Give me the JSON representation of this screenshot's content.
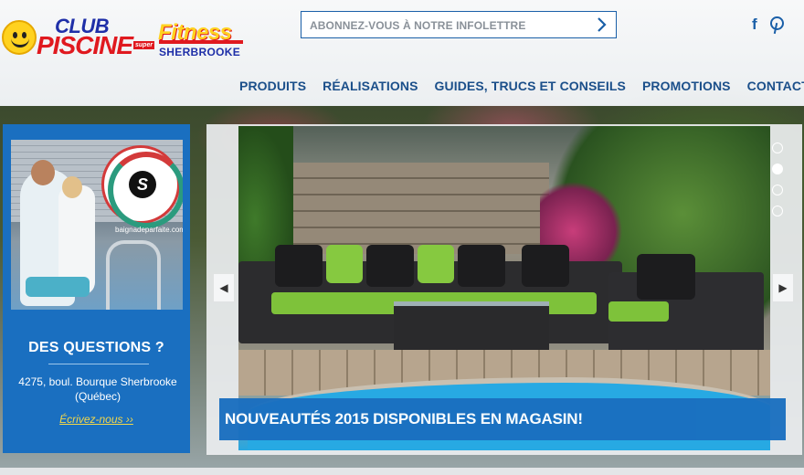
{
  "header": {
    "logo": {
      "club": "CLUB",
      "piscine": "PISCINE",
      "super": "super",
      "fitness": "Fitness",
      "location": "SHERBROOKE"
    },
    "newsletter": {
      "label": "ABONNEZ-VOUS À NOTRE INFOLETTRE",
      "arrow_icon": "chevron-right-icon"
    },
    "social": [
      {
        "name": "facebook-icon",
        "glyph": "f"
      },
      {
        "name": "pinterest-icon",
        "glyph": "p"
      }
    ]
  },
  "nav": {
    "items": [
      {
        "label": "PRODUITS"
      },
      {
        "label": "RÉALISATIONS"
      },
      {
        "label": "GUIDES, TRUCS ET CONSEILS"
      },
      {
        "label": "PROMOTIONS"
      },
      {
        "label": "CONTACT"
      }
    ]
  },
  "promo": {
    "badge_url": "baignadeparfaite.com",
    "title": "DES QUESTIONS ?",
    "address_line1": "4275, boul. Bourque Sherbrooke",
    "address_line2": "(Québec)",
    "link": "Écrivez-nous ››"
  },
  "slider": {
    "caption": "NOUVEAUTÉS 2015 DISPONIBLES EN MAGASIN!",
    "prev_glyph": "◀",
    "next_glyph": "▶",
    "active_index": 1,
    "slide_count": 4
  },
  "colors": {
    "brand_blue": "#1a6fc0",
    "nav_blue": "#1b4f8a",
    "logo_red": "#e0191f",
    "logo_yellow": "#ffd21f",
    "link_yellow": "#f2d74b"
  }
}
